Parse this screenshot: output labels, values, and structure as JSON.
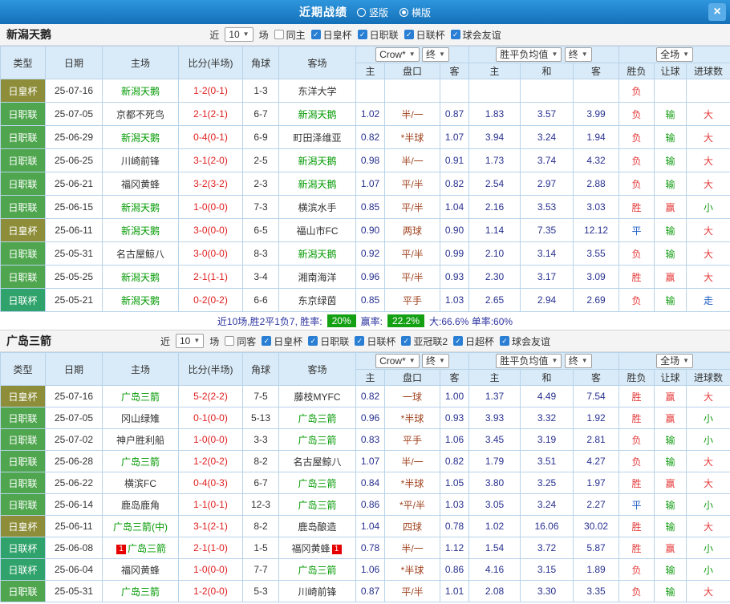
{
  "topbar": {
    "title": "近期战绩",
    "vertical": "竖版",
    "horizontal": "横版",
    "close": "×"
  },
  "cols": {
    "type": "类型",
    "date": "日期",
    "home": "主场",
    "score": "比分(半场)",
    "corner": "角球",
    "away": "客场",
    "book": "Crow*",
    "final": "终",
    "avg": "胜平负均值",
    "final2": "终",
    "full": "全场",
    "h": "主",
    "hd": "盘口",
    "a": "客",
    "h2": "主",
    "d": "和",
    "a2": "客",
    "wdl": "胜负",
    "rq": "让球",
    "jq": "进球数"
  },
  "type_colors": {
    "日皇杯": "#8e8e3a",
    "日职联": "#4fa64f",
    "日联杯": "#2fa36b"
  },
  "result_colors": {
    "胜": "#e53a3a",
    "负": "#e53a3a",
    "平": "#1f5fc4",
    "赢": "#e53a3a",
    "输": "#129c12",
    "走": "#1f5fc4",
    "大": "#e53a3a",
    "小": "#129c12"
  },
  "palette": {
    "score": "#e02020",
    "odds": "#28318f",
    "handicap": "#a0431f",
    "focus_team": "#009900",
    "badge_green": "#13a113",
    "summary_text": "#2d34a0",
    "red_card": "#e60000"
  },
  "sections": [
    {
      "team": "新潟天鹅",
      "filter": {
        "near": "近",
        "count": "10",
        "games": "场",
        "same": "同主",
        "leagues": [
          "日皇杯",
          "日职联",
          "日联杯",
          "球会友谊"
        ]
      },
      "rows": [
        {
          "type": "日皇杯",
          "date": "25-07-16",
          "home": "新潟天鹅",
          "score": "1-2(0-1)",
          "corner": "1-3",
          "away": "东洋大学",
          "o1": "",
          "pk": "",
          "o2": "",
          "a1": "",
          "a2": "",
          "a3": "",
          "r1": "负",
          "r2": "",
          "r3": ""
        },
        {
          "type": "日职联",
          "date": "25-07-05",
          "home": "京都不死鸟",
          "score": "2-1(2-1)",
          "corner": "6-7",
          "away": "新潟天鹅",
          "o1": "1.02",
          "pk": "半/一",
          "o2": "0.87",
          "a1": "1.83",
          "a2": "3.57",
          "a3": "3.99",
          "r1": "负",
          "r2": "输",
          "r3": "大"
        },
        {
          "type": "日职联",
          "date": "25-06-29",
          "home": "新潟天鹅",
          "score": "0-4(0-1)",
          "corner": "6-9",
          "away": "町田泽维亚",
          "o1": "0.82",
          "pk": "*半球",
          "o2": "1.07",
          "a1": "3.94",
          "a2": "3.24",
          "a3": "1.94",
          "r1": "负",
          "r2": "输",
          "r3": "大"
        },
        {
          "type": "日职联",
          "date": "25-06-25",
          "home": "川崎前锋",
          "score": "3-1(2-0)",
          "corner": "2-5",
          "away": "新潟天鹅",
          "o1": "0.98",
          "pk": "半/一",
          "o2": "0.91",
          "a1": "1.73",
          "a2": "3.74",
          "a3": "4.32",
          "r1": "负",
          "r2": "输",
          "r3": "大"
        },
        {
          "type": "日职联",
          "date": "25-06-21",
          "home": "福冈黄蜂",
          "score": "3-2(3-2)",
          "corner": "2-3",
          "away": "新潟天鹅",
          "o1": "1.07",
          "pk": "平/半",
          "o2": "0.82",
          "a1": "2.54",
          "a2": "2.97",
          "a3": "2.88",
          "r1": "负",
          "r2": "输",
          "r3": "大"
        },
        {
          "type": "日职联",
          "date": "25-06-15",
          "home": "新潟天鹅",
          "score": "1-0(0-0)",
          "corner": "7-3",
          "away": "横滨水手",
          "o1": "0.85",
          "pk": "平/半",
          "o2": "1.04",
          "a1": "2.16",
          "a2": "3.53",
          "a3": "3.03",
          "r1": "胜",
          "r2": "赢",
          "r3": "小"
        },
        {
          "type": "日皇杯",
          "date": "25-06-11",
          "home": "新潟天鹅",
          "score": "3-0(0-0)",
          "corner": "6-5",
          "away": "福山市FC",
          "o1": "0.90",
          "pk": "两球",
          "o2": "0.90",
          "a1": "1.14",
          "a2": "7.35",
          "a3": "12.12",
          "r1": "平",
          "r2": "输",
          "r3": "大"
        },
        {
          "type": "日职联",
          "date": "25-05-31",
          "home": "名古屋鲸八",
          "score": "3-0(0-0)",
          "corner": "8-3",
          "away": "新潟天鹅",
          "o1": "0.92",
          "pk": "平/半",
          "o2": "0.99",
          "a1": "2.10",
          "a2": "3.14",
          "a3": "3.55",
          "r1": "负",
          "r2": "输",
          "r3": "大"
        },
        {
          "type": "日职联",
          "date": "25-05-25",
          "home": "新潟天鹅",
          "score": "2-1(1-1)",
          "corner": "3-4",
          "away": "湘南海洋",
          "o1": "0.96",
          "pk": "平/半",
          "o2": "0.93",
          "a1": "2.30",
          "a2": "3.17",
          "a3": "3.09",
          "r1": "胜",
          "r2": "赢",
          "r3": "大"
        },
        {
          "type": "日联杯",
          "date": "25-05-21",
          "home": "新潟天鹅",
          "score": "0-2(0-2)",
          "corner": "6-6",
          "away": "东京绿茵",
          "o1": "0.85",
          "pk": "平手",
          "o2": "1.03",
          "a1": "2.65",
          "a2": "2.94",
          "a3": "2.69",
          "r1": "负",
          "r2": "输",
          "r3": "走"
        }
      ],
      "summary": {
        "text1": "近10场,胜2平1负7, 胜率:",
        "badge1": "20%",
        "text2": "赢率:",
        "badge2": "22.2%",
        "text3": "大:66.6% 单率:60%"
      }
    },
    {
      "team": "广岛三箭",
      "filter": {
        "near": "近",
        "count": "10",
        "games": "场",
        "same": "同客",
        "leagues": [
          "日皇杯",
          "日职联",
          "日联杯",
          "亚冠联2",
          "日超杯",
          "球会友谊"
        ]
      },
      "rows": [
        {
          "type": "日皇杯",
          "date": "25-07-16",
          "home": "广岛三箭",
          "score": "5-2(2-2)",
          "corner": "7-5",
          "away": "藤枝MYFC",
          "o1": "0.82",
          "pk": "一球",
          "o2": "1.00",
          "a1": "1.37",
          "a2": "4.49",
          "a3": "7.54",
          "r1": "胜",
          "r2": "赢",
          "r3": "大"
        },
        {
          "type": "日职联",
          "date": "25-07-05",
          "home": "冈山绿雉",
          "score": "0-1(0-0)",
          "corner": "5-13",
          "away": "广岛三箭",
          "o1": "0.96",
          "pk": "*半球",
          "o2": "0.93",
          "a1": "3.93",
          "a2": "3.32",
          "a3": "1.92",
          "r1": "胜",
          "r2": "赢",
          "r3": "小"
        },
        {
          "type": "日职联",
          "date": "25-07-02",
          "home": "神户胜利船",
          "score": "1-0(0-0)",
          "corner": "3-3",
          "away": "广岛三箭",
          "o1": "0.83",
          "pk": "平手",
          "o2": "1.06",
          "a1": "3.45",
          "a2": "3.19",
          "a3": "2.81",
          "r1": "负",
          "r2": "输",
          "r3": "小"
        },
        {
          "type": "日职联",
          "date": "25-06-28",
          "home": "广岛三箭",
          "score": "1-2(0-2)",
          "corner": "8-2",
          "away": "名古屋鲸八",
          "o1": "1.07",
          "pk": "半/一",
          "o2": "0.82",
          "a1": "1.79",
          "a2": "3.51",
          "a3": "4.27",
          "r1": "负",
          "r2": "输",
          "r3": "大"
        },
        {
          "type": "日职联",
          "date": "25-06-22",
          "home": "横滨FC",
          "score": "0-4(0-3)",
          "corner": "6-7",
          "away": "广岛三箭",
          "o1": "0.84",
          "pk": "*半球",
          "o2": "1.05",
          "a1": "3.80",
          "a2": "3.25",
          "a3": "1.97",
          "r1": "胜",
          "r2": "赢",
          "r3": "大"
        },
        {
          "type": "日职联",
          "date": "25-06-14",
          "home": "鹿岛鹿角",
          "score": "1-1(0-1)",
          "corner": "12-3",
          "away": "广岛三箭",
          "o1": "0.86",
          "pk": "*平/半",
          "o2": "1.03",
          "a1": "3.05",
          "a2": "3.24",
          "a3": "2.27",
          "r1": "平",
          "r2": "输",
          "r3": "小"
        },
        {
          "type": "日皇杯",
          "date": "25-06-11",
          "home": "广岛三箭(中)",
          "score": "3-1(2-1)",
          "corner": "8-2",
          "away": "鹿岛酿造",
          "o1": "1.04",
          "pk": "四球",
          "o2": "0.78",
          "a1": "1.02",
          "a2": "16.06",
          "a3": "30.02",
          "r1": "胜",
          "r2": "输",
          "r3": "大"
        },
        {
          "type": "日联杯",
          "date": "25-06-08",
          "home": "广岛三箭",
          "hrc": "1",
          "score": "2-1(1-0)",
          "corner": "1-5",
          "away": "福冈黄蜂",
          "arc": "1",
          "o1": "0.78",
          "pk": "半/一",
          "o2": "1.12",
          "a1": "1.54",
          "a2": "3.72",
          "a3": "5.87",
          "r1": "胜",
          "r2": "赢",
          "r3": "小"
        },
        {
          "type": "日联杯",
          "date": "25-06-04",
          "home": "福冈黄蜂",
          "score": "1-0(0-0)",
          "corner": "7-7",
          "away": "广岛三箭",
          "o1": "1.06",
          "pk": "*半球",
          "o2": "0.86",
          "a1": "4.16",
          "a2": "3.15",
          "a3": "1.89",
          "r1": "负",
          "r2": "输",
          "r3": "小"
        },
        {
          "type": "日职联",
          "date": "25-05-31",
          "home": "广岛三箭",
          "score": "1-2(0-0)",
          "corner": "5-3",
          "away": "川崎前锋",
          "o1": "0.87",
          "pk": "平/半",
          "o2": "1.01",
          "a1": "2.08",
          "a2": "3.30",
          "a3": "3.35",
          "r1": "负",
          "r2": "输",
          "r3": "大"
        }
      ]
    }
  ]
}
